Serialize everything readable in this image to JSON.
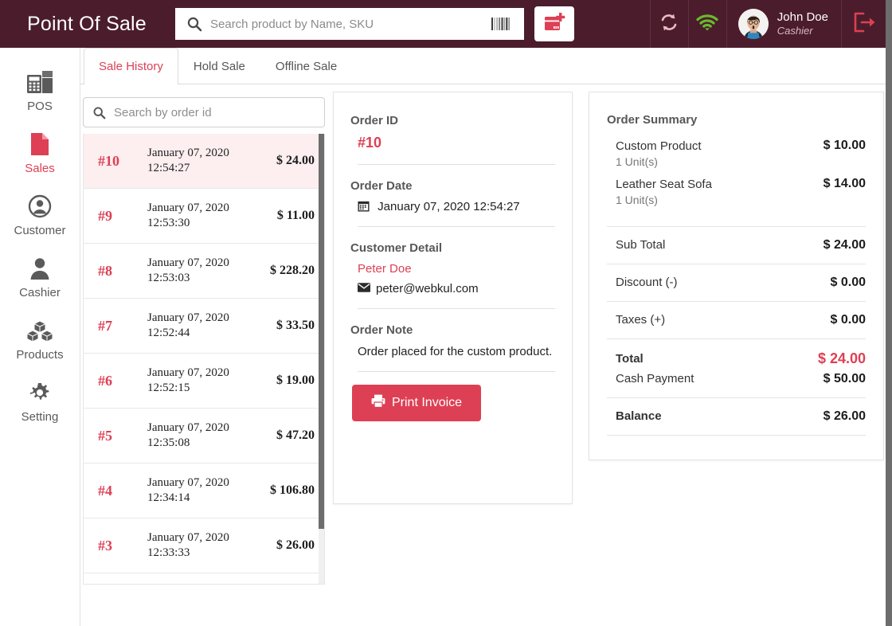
{
  "header": {
    "brand": "Point Of Sale",
    "search_placeholder": "Search product by Name, SKU",
    "search_value": "",
    "barcode_icon": "barcode-icon",
    "new_sale_icon": "new-sale-icon",
    "sync_icon": "sync-icon",
    "wifi_icon": "wifi-icon",
    "user_name": "John Doe",
    "user_role": "Cashier",
    "logout_icon": "logout-icon",
    "colors": {
      "bar": "#4b1d2c",
      "accent": "#dd4054",
      "wifi": "#6aba2e",
      "sync": "#f0b8c4"
    }
  },
  "sidebar": {
    "items": [
      {
        "label": "POS",
        "icon": "pos-terminal-icon",
        "active": false
      },
      {
        "label": "Sales",
        "icon": "document-icon",
        "active": true
      },
      {
        "label": "Customer",
        "icon": "user-circle-icon",
        "active": false
      },
      {
        "label": "Cashier",
        "icon": "user-icon",
        "active": false
      },
      {
        "label": "Products",
        "icon": "boxes-icon",
        "active": false
      },
      {
        "label": "Setting",
        "icon": "gear-icon",
        "active": false
      }
    ]
  },
  "tabs": [
    {
      "label": "Sale History",
      "active": true
    },
    {
      "label": "Hold Sale",
      "active": false
    },
    {
      "label": "Offline Sale",
      "active": false
    }
  ],
  "order_search": {
    "placeholder": "Search by order id",
    "value": ""
  },
  "orders": [
    {
      "id": "#10",
      "date": "January 07, 2020",
      "time": "12:54:27",
      "amount": "$ 24.00",
      "selected": true
    },
    {
      "id": "#9",
      "date": "January 07, 2020",
      "time": "12:53:30",
      "amount": "$ 11.00",
      "selected": false
    },
    {
      "id": "#8",
      "date": "January 07, 2020",
      "time": "12:53:03",
      "amount": "$ 228.20",
      "selected": false
    },
    {
      "id": "#7",
      "date": "January 07, 2020",
      "time": "12:52:44",
      "amount": "$ 33.50",
      "selected": false
    },
    {
      "id": "#6",
      "date": "January 07, 2020",
      "time": "12:52:15",
      "amount": "$ 19.00",
      "selected": false
    },
    {
      "id": "#5",
      "date": "January 07, 2020",
      "time": "12:35:08",
      "amount": "$ 47.20",
      "selected": false
    },
    {
      "id": "#4",
      "date": "January 07, 2020",
      "time": "12:34:14",
      "amount": "$ 106.80",
      "selected": false
    },
    {
      "id": "#3",
      "date": "January 07, 2020",
      "time": "12:33:33",
      "amount": "$ 26.00",
      "selected": false
    }
  ],
  "detail": {
    "order_id_label": "Order ID",
    "order_id": "#10",
    "order_date_label": "Order Date",
    "order_date": "January 07, 2020 12:54:27",
    "calendar_icon": "calendar-icon",
    "customer_label": "Customer Detail",
    "customer_name": "Peter Doe",
    "customer_email": "peter@webkul.com",
    "envelope_icon": "envelope-icon",
    "note_label": "Order Note",
    "note": "Order placed for the custom product.",
    "print_label": "Print Invoice",
    "print_icon": "printer-icon"
  },
  "summary": {
    "title": "Order Summary",
    "items": [
      {
        "name": "Custom Product",
        "units": "1 Unit(s)",
        "amount": "$ 10.00"
      },
      {
        "name": "Leather Seat Sofa",
        "units": "1 Unit(s)",
        "amount": "$ 14.00"
      }
    ],
    "rows": [
      {
        "label": "Sub Total",
        "value": "$ 24.00"
      },
      {
        "label": "Discount (-)",
        "value": "$ 0.00"
      },
      {
        "label": "Taxes (+)",
        "value": "$ 0.00"
      }
    ],
    "total_label": "Total",
    "total_value": "$ 24.00",
    "cash_label": "Cash Payment",
    "cash_value": "$ 50.00",
    "balance_label": "Balance",
    "balance_value": "$ 26.00"
  }
}
